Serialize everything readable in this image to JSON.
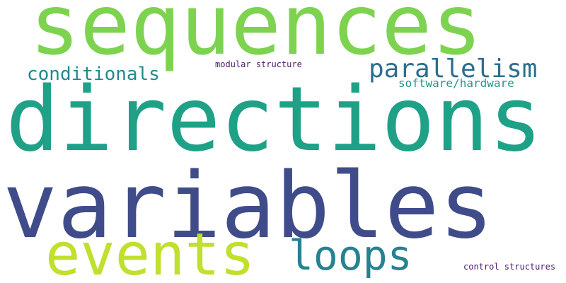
{
  "cloud": {
    "background": "#ffffff",
    "words": {
      "sequences": {
        "text": "sequences",
        "color": "#7dd34f"
      },
      "directions": {
        "text": "directions",
        "color": "#1fa187"
      },
      "variables": {
        "text": "variables",
        "color": "#404c8a"
      },
      "events": {
        "text": "events",
        "color": "#bfe02d"
      },
      "loops": {
        "text": "loops",
        "color": "#26828e"
      },
      "parallelism": {
        "text": "parallelism",
        "color": "#2c6e8f"
      },
      "conditionals": {
        "text": "conditionals",
        "color": "#23888e"
      },
      "software_hardware": {
        "text": "software/hardware",
        "color": "#1f968b"
      },
      "modular": {
        "text": "modular structure",
        "color": "#4b186c"
      },
      "control": {
        "text": "control structures",
        "color": "#4b186c"
      }
    }
  }
}
